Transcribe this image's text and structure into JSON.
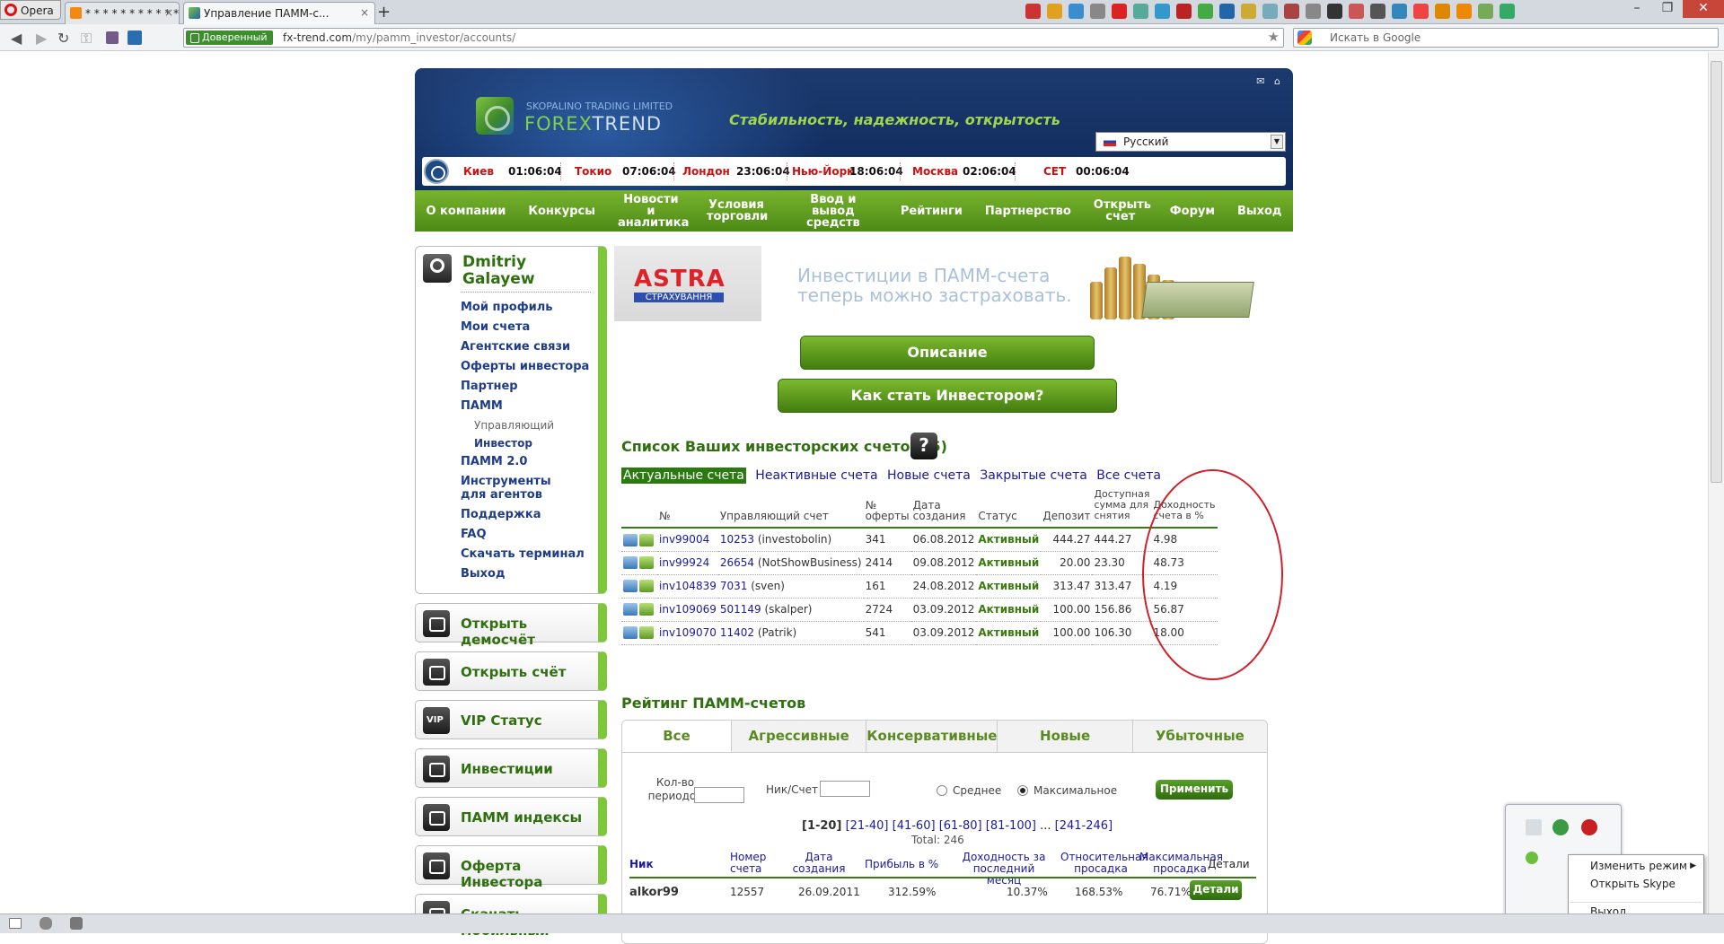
{
  "browser": {
    "opera_label": "Opera",
    "tabs": [
      {
        "label": "* * * * * * * * * * * * *",
        "close": "×"
      },
      {
        "label": "Управление ПАММ-с...",
        "close": "×"
      }
    ],
    "new_tab": "+",
    "trusted_label": "Доверенный",
    "url_host": "fx-trend.com",
    "url_path": "/my/pamm_investor/accounts/",
    "search_placeholder": "Искать в Google",
    "win_min": "–",
    "win_max": "❐",
    "win_close": "✕"
  },
  "header": {
    "company": "SKOPALINO TRADING LIMITED",
    "brand_a": "FOREX",
    "brand_b": "TREND",
    "slogan": "Стабильность, надежность, открытость",
    "mail_icon": "✉",
    "home_icon": "⌂",
    "language": "Русский",
    "clocks": [
      {
        "city": "Киев",
        "time": "01:06:04"
      },
      {
        "city": "Токио",
        "time": "07:06:04"
      },
      {
        "city": "Лондон",
        "time": "23:06:04"
      },
      {
        "city": "Нью-Йорк",
        "time": "18:06:04"
      },
      {
        "city": "Москва",
        "time": "02:06:04"
      },
      {
        "city": "CET",
        "time": "00:06:04"
      }
    ]
  },
  "topnav": [
    "О компании",
    "Конкурсы",
    "Новости и аналитика",
    "Условия торговли",
    "Ввод и вывод средств",
    "Рейтинги",
    "Партнерство",
    "Открыть счет",
    "Форум",
    "Выход"
  ],
  "sidebar": {
    "user_name": "Dmitriy Galayew",
    "menu": [
      "Мой профиль",
      "Мои счета",
      "Агентские связи",
      "Оферты инвестора",
      "Партнер",
      "ПАММ",
      "Управляющий",
      "Инвестор",
      "ПАММ 2.0",
      "Инструменты для агентов",
      "Поддержка",
      "FAQ",
      "Скачать терминал",
      "Выход"
    ],
    "boxes": [
      "Открыть демосчёт",
      "Открыть счёт",
      "VIP Статус",
      "Инвестиции",
      "ПАММ индексы",
      "Оферта Инвестора",
      "Скачать мобильный"
    ]
  },
  "banner": {
    "astra_name": "ASTRA",
    "astra_sub": "СТРАХУВАННЯ",
    "text_line1": "Инвестиции в ПАММ-счета",
    "text_line2": "теперь можно застраховать."
  },
  "buttons": {
    "description": "Описание",
    "how_to": "Как стать Инвестором?"
  },
  "accounts": {
    "title": "Список Ваших инвесторских счетов (5)",
    "help": "?",
    "filters": [
      "Актуальные счета",
      "Неактивные счета",
      "Новые счета",
      "Закрытые счета",
      "Все счета"
    ],
    "columns": [
      "№",
      "Управляющий счет",
      "№ оферты",
      "Дата создания",
      "Статус",
      "Депозит",
      "Доступная сумма для снятия",
      "Доходность счета в %"
    ],
    "rows": [
      {
        "num": "inv99004",
        "mgr": "10253",
        "mgr_name": "(investobolin)",
        "offer": "341",
        "date": "06.08.2012",
        "status": "Активный",
        "deposit": "444.27",
        "avail": "444.27",
        "yield": "4.98"
      },
      {
        "num": "inv99924",
        "mgr": "26654",
        "mgr_name": "(NotShowBusiness)",
        "offer": "2414",
        "date": "09.08.2012",
        "status": "Активный",
        "deposit": "20.00",
        "avail": "23.30",
        "yield": "48.73"
      },
      {
        "num": "inv104839",
        "mgr": "7031",
        "mgr_name": "(sven)",
        "offer": "161",
        "date": "24.08.2012",
        "status": "Активный",
        "deposit": "313.47",
        "avail": "313.47",
        "yield": "4.19"
      },
      {
        "num": "inv109069",
        "mgr": "501149",
        "mgr_name": "(skalper)",
        "offer": "2724",
        "date": "03.09.2012",
        "status": "Активный",
        "deposit": "100.00",
        "avail": "156.86",
        "yield": "56.87"
      },
      {
        "num": "inv109070",
        "mgr": "11402",
        "mgr_name": "(Patrik)",
        "offer": "541",
        "date": "03.09.2012",
        "status": "Активный",
        "deposit": "100.00",
        "avail": "106.30",
        "yield": "18.00"
      }
    ]
  },
  "rating": {
    "title": "Рейтинг ПАММ-счетов",
    "tabs": [
      "Все",
      "Агрессивные",
      "Консервативные",
      "Новые",
      "Убыточные"
    ],
    "periods_label": "Кол-во периодов",
    "nick_label": "Ник/Счет",
    "avg_label": "Среднее",
    "max_label": "Максимальное",
    "apply": "Применить",
    "pager": {
      "current": "[1-20]",
      "links": [
        "[21-40]",
        "[41-60]",
        "[61-80]",
        "[81-100]"
      ],
      "dots": "...",
      "last": "[241-246]"
    },
    "total": "Total: 246",
    "columns": [
      "Ник",
      "Номер счета",
      "Дата создания",
      "Прибыль в %",
      "Доходность за последний месяц",
      "Относительная просадка",
      "Максимальная просадка",
      "Детали"
    ],
    "row": {
      "nick": "alkor99",
      "account": "12557",
      "date": "26.09.2011",
      "profit": "312.59%",
      "month": "10.37%",
      "rel": "168.53%",
      "max": "76.71%",
      "details": "Детали"
    }
  },
  "tray_menu": {
    "items": [
      "Изменить режим",
      "Открыть Skype",
      "Выход"
    ],
    "arrow": "▶"
  }
}
